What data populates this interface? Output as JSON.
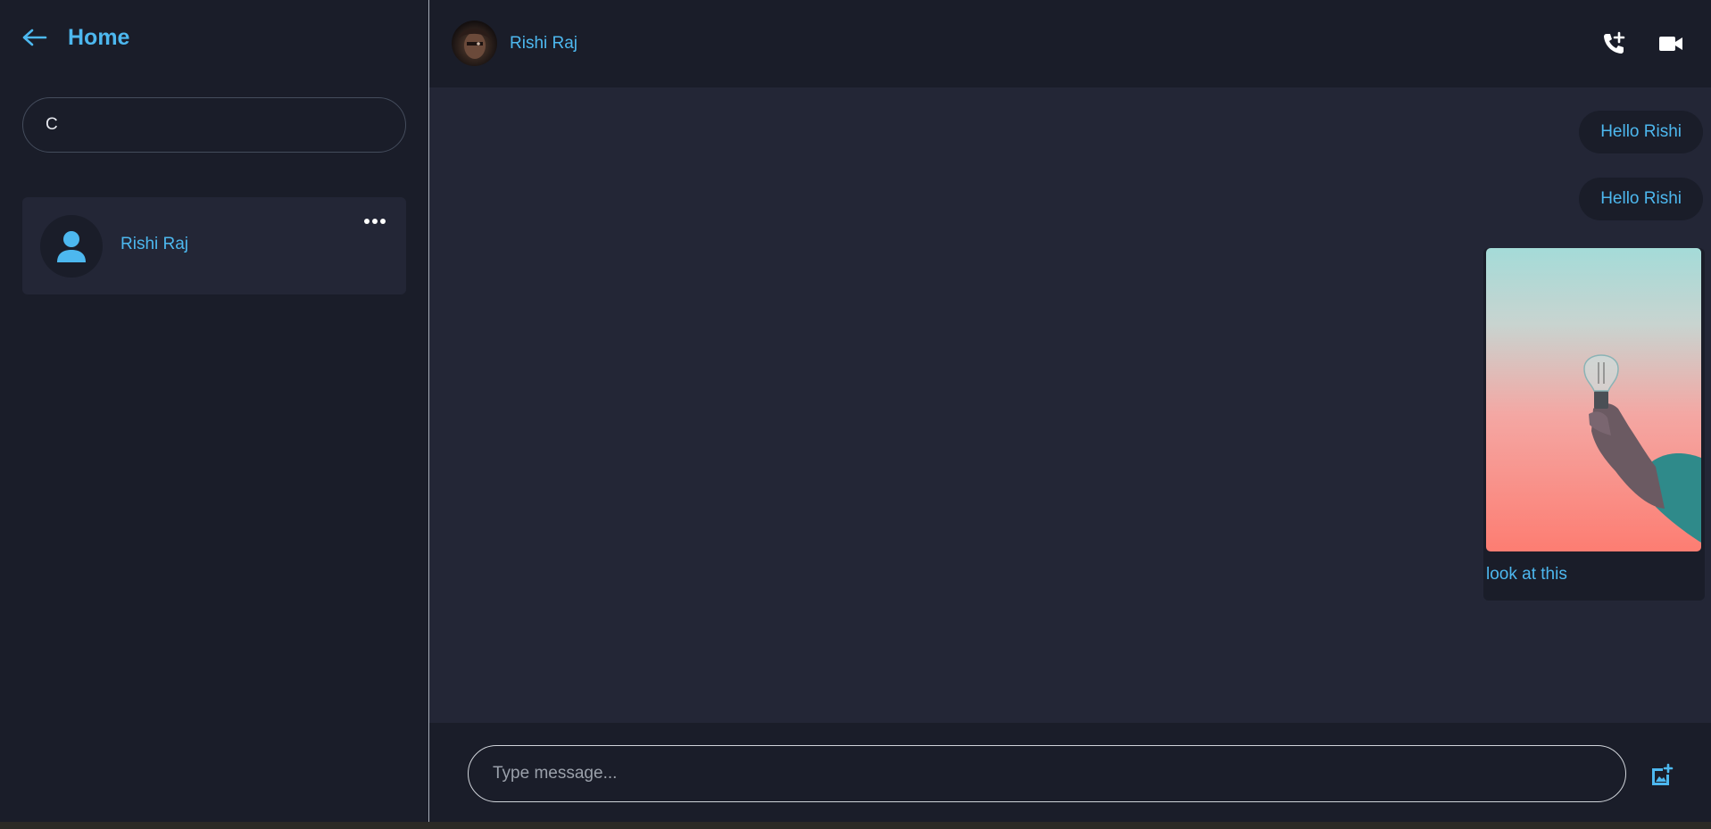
{
  "sidebar": {
    "home_label": "Home",
    "search_value": "C",
    "contacts": [
      {
        "name": "Rishi Raj"
      }
    ]
  },
  "chat": {
    "contact_name": "Rishi Raj",
    "messages": [
      {
        "type": "text",
        "text": "Hello Rishi"
      },
      {
        "type": "text",
        "text": "Hello Rishi"
      },
      {
        "type": "image",
        "caption": "look at this"
      }
    ]
  },
  "composer": {
    "placeholder": "Type message..."
  },
  "icons": {
    "back": "arrow-left-icon",
    "more": "more-horizontal-icon",
    "call": "phone-add-icon",
    "video": "video-camera-icon",
    "attach": "add-photo-icon",
    "default_avatar": "person-icon"
  },
  "colors": {
    "accent": "#4db8ef",
    "background": "#1a1d29",
    "panel": "#232636",
    "text_light": "#e6e8ee"
  }
}
